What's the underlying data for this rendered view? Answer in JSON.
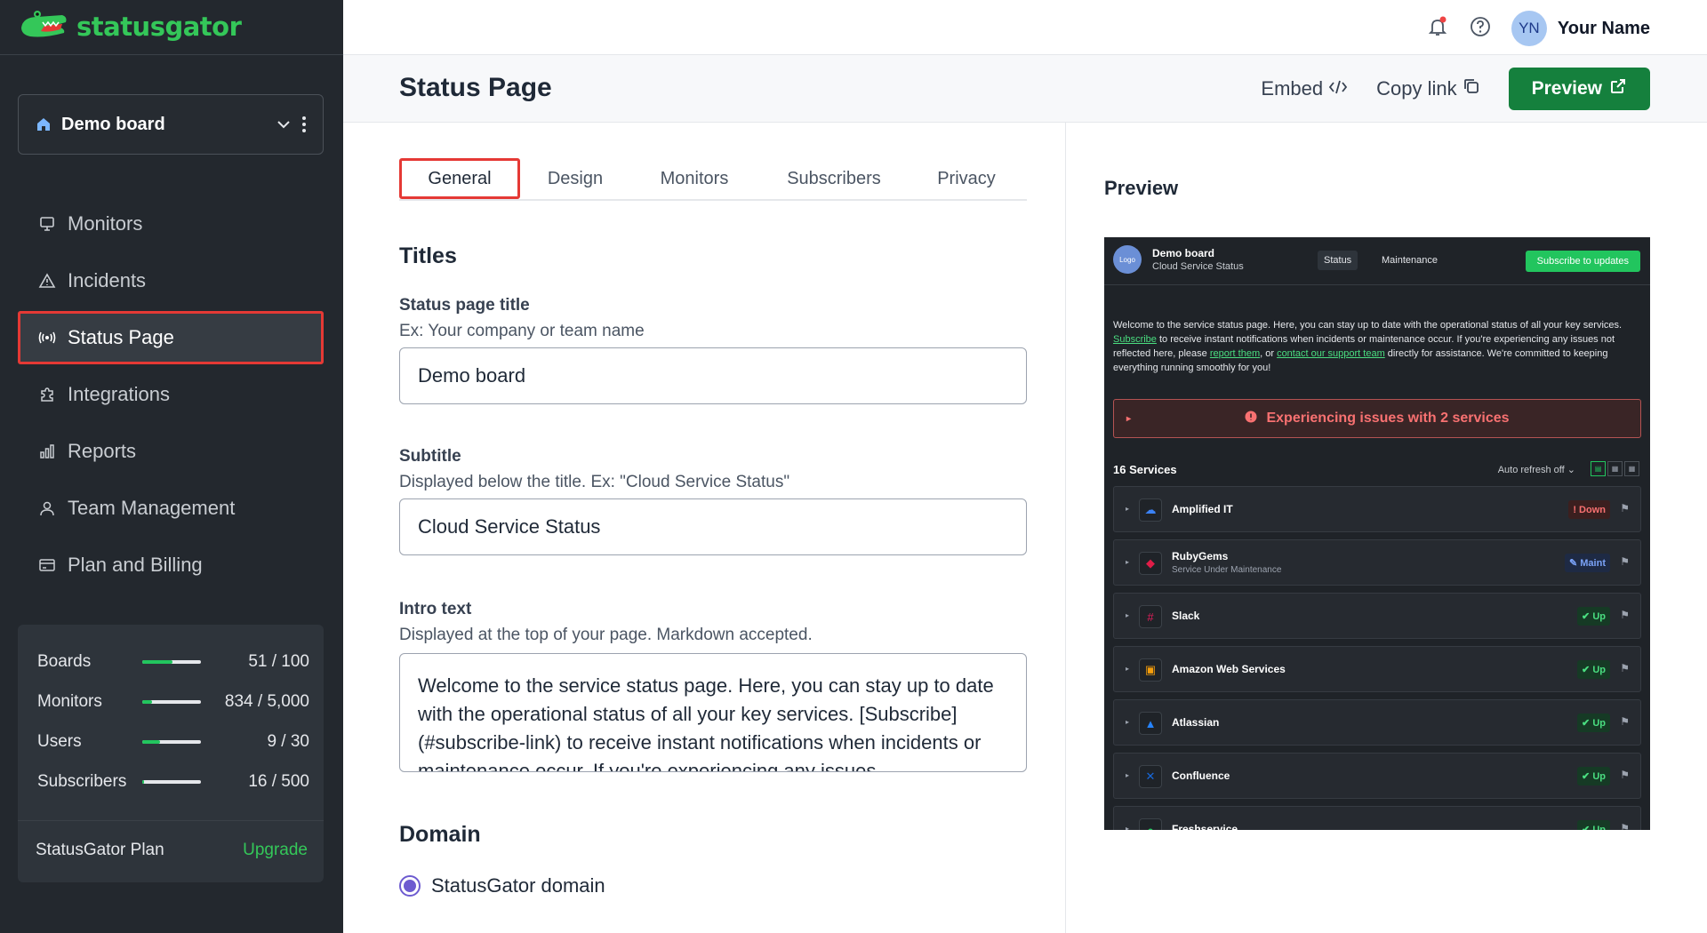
{
  "app": {
    "name": "statusgator"
  },
  "sidebar": {
    "board": {
      "name": "Demo board"
    },
    "items": [
      {
        "label": "Monitors",
        "icon": "monitor-icon"
      },
      {
        "label": "Incidents",
        "icon": "warning-icon"
      },
      {
        "label": "Status Page",
        "icon": "broadcast-icon",
        "active": true
      },
      {
        "label": "Integrations",
        "icon": "puzzle-icon"
      },
      {
        "label": "Reports",
        "icon": "bar-chart-icon"
      },
      {
        "label": "Team Management",
        "icon": "user-icon"
      },
      {
        "label": "Plan and Billing",
        "icon": "credit-card-icon"
      }
    ],
    "usage": [
      {
        "label": "Boards",
        "value": "51 / 100",
        "fraction": 0.51
      },
      {
        "label": "Monitors",
        "value": "834 / 5,000",
        "fraction": 0.167
      },
      {
        "label": "Users",
        "value": "9 / 30",
        "fraction": 0.3
      },
      {
        "label": "Subscribers",
        "value": "16 / 500",
        "fraction": 0.032
      }
    ],
    "plan": {
      "label": "StatusGator Plan",
      "upgrade": "Upgrade"
    }
  },
  "topbar": {
    "user_initials": "YN",
    "user_name": "Your Name"
  },
  "page": {
    "title": "Status Page",
    "embed": "Embed",
    "copy_link": "Copy link",
    "preview": "Preview"
  },
  "tabs": [
    "General",
    "Design",
    "Monitors",
    "Subscribers",
    "Privacy"
  ],
  "form": {
    "titles_heading": "Titles",
    "title_label": "Status page title",
    "title_help": "Ex: Your company or team name",
    "title_value": "Demo board",
    "subtitle_label": "Subtitle",
    "subtitle_help": "Displayed below the title. Ex: \"Cloud Service Status\"",
    "subtitle_value": "Cloud Service Status",
    "intro_label": "Intro text",
    "intro_help": "Displayed at the top of your page. Markdown accepted.",
    "intro_value": "Welcome to the service status page. Here, you can stay up to date with the operational status of all your key services. [Subscribe](#subscribe-link) to receive instant notifications when incidents or maintenance occur. If you're experiencing any issues",
    "domain_heading": "Domain",
    "domain_option": "StatusGator domain"
  },
  "preview": {
    "heading": "Preview",
    "logo": "Logo",
    "board_name": "Demo board",
    "board_sub": "Cloud Service Status",
    "tab_status": "Status",
    "tab_maintenance": "Maintenance",
    "subscribe_btn": "Subscribe to updates",
    "intro_1": "Welcome to the service status page. Here, you can stay up to date with the operational status of all your key services. ",
    "intro_subscribe": "Subscribe",
    "intro_2": " to receive instant notifications when incidents or maintenance occur. If you're experiencing any issues not reflected here, please ",
    "intro_report": "report them",
    "intro_3": ", or ",
    "intro_contact": "contact our support team",
    "intro_4": " directly for assistance. We're committed to keeping everything running smoothly for you!",
    "alert": "Experiencing issues with 2 services",
    "service_count": "16 Services",
    "auto_refresh": "Auto refresh off",
    "services": [
      {
        "name": "Amplified IT",
        "sub": "",
        "status": "Down",
        "kind": "down",
        "icon": "cloud-icon",
        "color": "#3b82f6"
      },
      {
        "name": "RubyGems",
        "sub": "Service Under Maintenance",
        "status": "Maint",
        "kind": "maint",
        "icon": "ruby-icon",
        "color": "#e11d48"
      },
      {
        "name": "Slack",
        "sub": "",
        "status": "Up",
        "kind": "up",
        "icon": "slack-icon",
        "color": "#e01e5a"
      },
      {
        "name": "Amazon Web Services",
        "sub": "",
        "status": "Up",
        "kind": "up",
        "icon": "box-icon",
        "color": "#f59e0b"
      },
      {
        "name": "Atlassian",
        "sub": "",
        "status": "Up",
        "kind": "up",
        "icon": "atlassian-icon",
        "color": "#2684ff"
      },
      {
        "name": "Confluence",
        "sub": "",
        "status": "Up",
        "kind": "up",
        "icon": "confluence-icon",
        "color": "#1868db"
      },
      {
        "name": "Freshservice",
        "sub": "",
        "status": "Up",
        "kind": "up",
        "icon": "freshservice-icon",
        "color": "#22c55e"
      }
    ]
  }
}
